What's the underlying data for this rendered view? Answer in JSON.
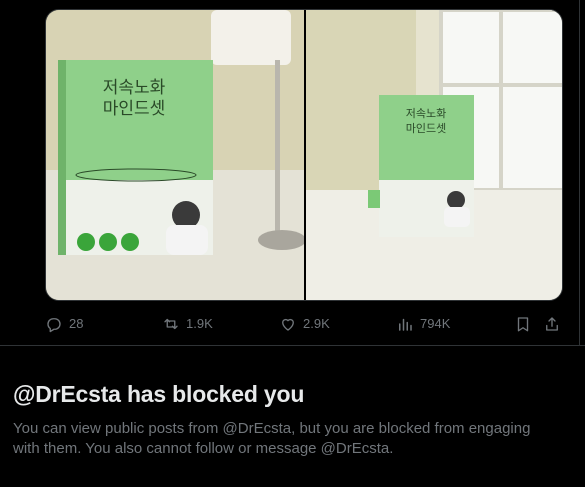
{
  "post": {
    "media": {
      "images": [
        {
          "book_title_line1": "저속노화",
          "book_title_line2": "마인드셋",
          "description": "book on desk next to lamp"
        },
        {
          "book_title_line1": "저속노화",
          "book_title_line2": "마인드셋",
          "description": "book on windowsill"
        }
      ]
    },
    "actions": {
      "replies": "28",
      "reposts": "1.9K",
      "likes": "2.9K",
      "views": "794K"
    }
  },
  "blocked_notice": {
    "title": "@DrEcsta has blocked you",
    "description": "You can view public posts from @DrEcsta, but you are blocked from engaging with them. You also cannot follow or message @DrEcsta."
  },
  "colors": {
    "background": "#000000",
    "text_primary": "#e7e9ea",
    "text_secondary": "#71767b",
    "border": "#2f3336",
    "book_green": "#8fd08a"
  }
}
